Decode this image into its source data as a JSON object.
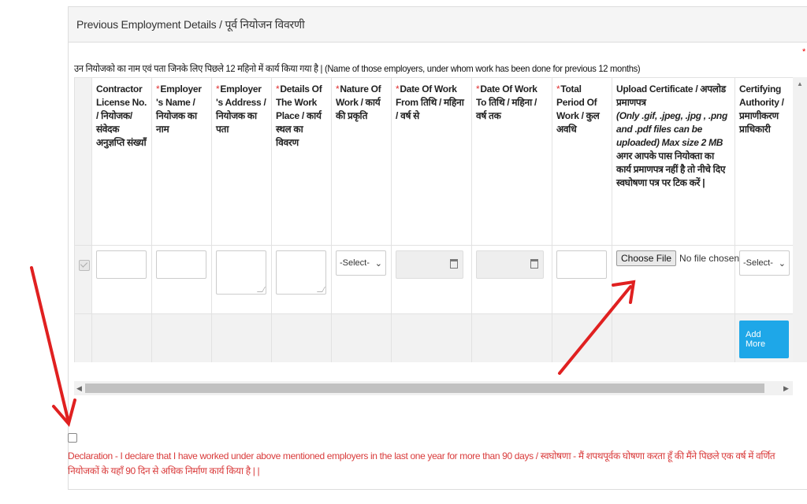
{
  "panel": {
    "title": "Previous Employment Details / पूर्व नियोजन विवरणी"
  },
  "intro": "उन नियोजको का नाम एवं पता जिनके लिए पिछले 12 महिनो में कार्य किया गया है | (Name of those employers, under whom work has been done for previous 12 months)",
  "columns": {
    "license": "Contractor License No. / नियोजक/ संवेदक अनुज्ञप्ति संख्याँ",
    "employer_name": "Employer 's Name / नियोजक का नाम",
    "employer_address": "Employer 's Address / नियोजक का पता",
    "work_place": "Details Of The Work Place / कार्य स्थल का विवरण",
    "nature": "Nature Of Work / कार्य की प्रकृति",
    "date_from": "Date Of Work From तिथि / महिना / वर्ष से",
    "date_to": "Date Of Work To तिथि / महिना / वर्ष तक",
    "total_period": "Total Period Of Work / कुल अवधि",
    "upload_title": "Upload Certificate / अपलोड प्रमाणपत्र",
    "upload_note": "(Only .gif, .jpeg, .jpg , .png and .pdf files can be uploaded) Max size 2 MB",
    "upload_hint": "अगर आपके पास नियोक्ता का कार्य प्रमाणपत्र नहीं है तो नीचे दिए स्वघोषणा पत्र पर टिक करें |",
    "authority": "Certifying Authority / प्रमाणीकरण प्राधिकारी"
  },
  "required_mark": "*",
  "row": {
    "nature_select": "-Select-",
    "authority_select": "-Select-",
    "file_button": "Choose File",
    "file_status": "No file chosen"
  },
  "add_more": "Add More",
  "declaration": "Declaration - I declare that I have worked under above mentioned employers in the last one year for more than 90 days / स्वघोषणा - मैं शपथपूर्वक घोषणा करता हूँ की मैंने पिछले एक वर्ष में वर्णित नियोजकों के यहाँ 90 दिन से अधिक निर्माण कार्य किया है | |",
  "colors": {
    "accent": "#1ea7e8",
    "required": "#e03030",
    "declaration": "#d93b3b",
    "annotation": "#e02020"
  }
}
